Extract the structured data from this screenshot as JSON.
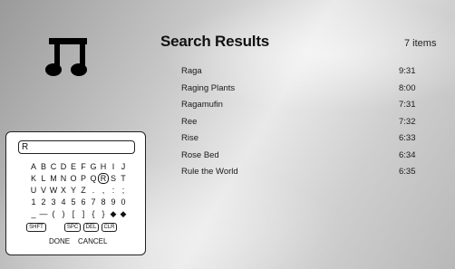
{
  "header": {
    "title": "Search Results",
    "count": "7 items"
  },
  "results": [
    {
      "name": "Raga",
      "time": "9:31"
    },
    {
      "name": "Raging Plants",
      "time": "8:00"
    },
    {
      "name": "Ragamufin",
      "time": "7:31"
    },
    {
      "name": "Ree",
      "time": "7:32"
    },
    {
      "name": "Rise",
      "time": "6:33"
    },
    {
      "name": "Rose Bed",
      "time": "6:34"
    },
    {
      "name": "Rule the World",
      "time": "6:35"
    }
  ],
  "keyboard": {
    "input_value": "R",
    "rows": [
      [
        "A",
        "B",
        "C",
        "D",
        "E",
        "F",
        "G",
        "H",
        "I",
        "J"
      ],
      [
        "K",
        "L",
        "M",
        "N",
        "O",
        "P",
        "Q",
        "R",
        "S",
        "T"
      ],
      [
        "U",
        "V",
        "W",
        "X",
        "Y",
        "Z",
        ".",
        ",",
        ":",
        ";"
      ],
      [
        "1",
        "2",
        "3",
        "4",
        "5",
        "6",
        "7",
        "8",
        "9",
        "0"
      ],
      [
        "_",
        "—",
        "(",
        ")",
        "[",
        "]",
        "{",
        "}",
        "◆",
        "◆"
      ]
    ],
    "selected_key": "R",
    "function_keys": {
      "shift": "SHFT",
      "space": "SPC",
      "delete": "DEL",
      "clear": "CLR"
    },
    "actions": {
      "done": "DONE",
      "cancel": "CANCEL"
    }
  },
  "icons": {
    "media": "music-note-icon"
  }
}
